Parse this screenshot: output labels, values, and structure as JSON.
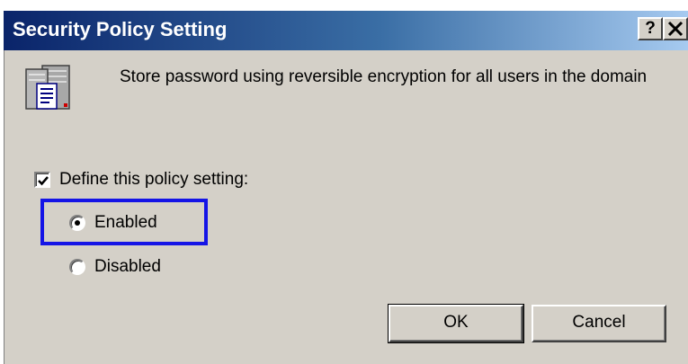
{
  "window": {
    "title": "Security Policy Setting",
    "help_glyph": "?",
    "close_glyph": "✕"
  },
  "policy": {
    "icon": "policy-document-icon",
    "description": "Store password using reversible encryption for all users in the domain"
  },
  "define_setting": {
    "label": "Define this policy setting:",
    "checked": true
  },
  "options": {
    "enabled_label": "Enabled",
    "disabled_label": "Disabled",
    "selected": "Enabled"
  },
  "buttons": {
    "ok_label": "OK",
    "cancel_label": "Cancel"
  },
  "colors": {
    "titlebar_start": "#0a246a",
    "titlebar_end": "#a6caf0",
    "dialog_face": "#d4d0c8",
    "highlight_border": "#1414e6"
  }
}
